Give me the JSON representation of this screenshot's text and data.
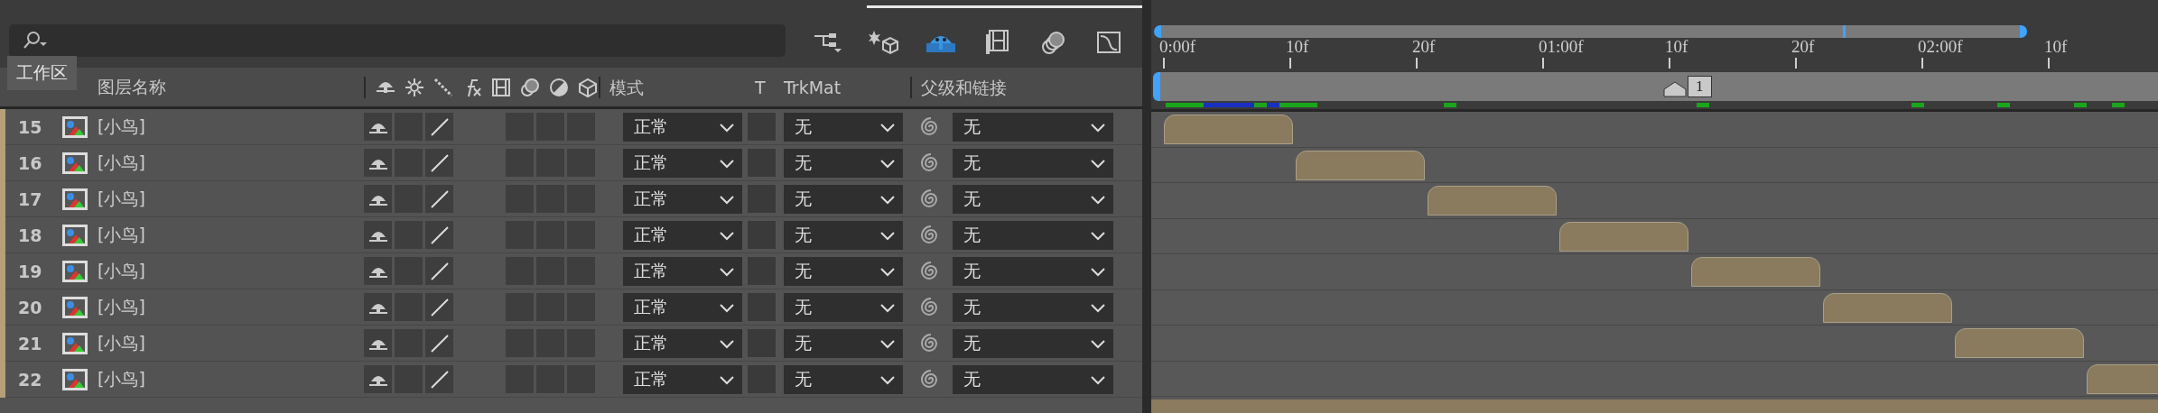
{
  "tooltip": "工作区",
  "toolbar": [
    {
      "kind": "flowchart",
      "selected": false
    },
    {
      "kind": "draft3d",
      "selected": false
    },
    {
      "kind": "shy",
      "selected": true
    },
    {
      "kind": "frameblend",
      "selected": false
    },
    {
      "kind": "motionblur",
      "selected": false
    },
    {
      "kind": "graph",
      "selected": false
    }
  ],
  "columns": {
    "name": "图层名称",
    "mode": "模式",
    "t": "T",
    "trkmat": "TrkMat",
    "parent": "父级和链接"
  },
  "ruler": [
    "0:00f",
    "10f",
    "20f",
    "01:00f",
    "10f",
    "20f",
    "02:00f",
    "10f"
  ],
  "marker": "1",
  "layers": [
    {
      "number": "15",
      "name": "[小鸟]",
      "shy": true,
      "best_quality": true,
      "mode": "正常",
      "preserve_transparency": false,
      "track_matte": "无",
      "parent": "无"
    },
    {
      "number": "16",
      "name": "[小鸟]",
      "shy": true,
      "best_quality": true,
      "mode": "正常",
      "preserve_transparency": false,
      "track_matte": "无",
      "parent": "无"
    },
    {
      "number": "17",
      "name": "[小鸟]",
      "shy": true,
      "best_quality": true,
      "mode": "正常",
      "preserve_transparency": false,
      "track_matte": "无",
      "parent": "无"
    },
    {
      "number": "18",
      "name": "[小鸟]",
      "shy": true,
      "best_quality": true,
      "mode": "正常",
      "preserve_transparency": false,
      "track_matte": "无",
      "parent": "无"
    },
    {
      "number": "19",
      "name": "[小鸟]",
      "shy": true,
      "best_quality": true,
      "mode": "正常",
      "preserve_transparency": false,
      "track_matte": "无",
      "parent": "无"
    },
    {
      "number": "20",
      "name": "[小鸟]",
      "shy": true,
      "best_quality": true,
      "mode": "正常",
      "preserve_transparency": false,
      "track_matte": "无",
      "parent": "无"
    },
    {
      "number": "21",
      "name": "[小鸟]",
      "shy": true,
      "best_quality": true,
      "mode": "正常",
      "preserve_transparency": false,
      "track_matte": "无",
      "parent": "无"
    },
    {
      "number": "22",
      "name": "[小鸟]",
      "shy": true,
      "best_quality": true,
      "mode": "正常",
      "preserve_transparency": false,
      "track_matte": "无",
      "parent": "无"
    }
  ]
}
